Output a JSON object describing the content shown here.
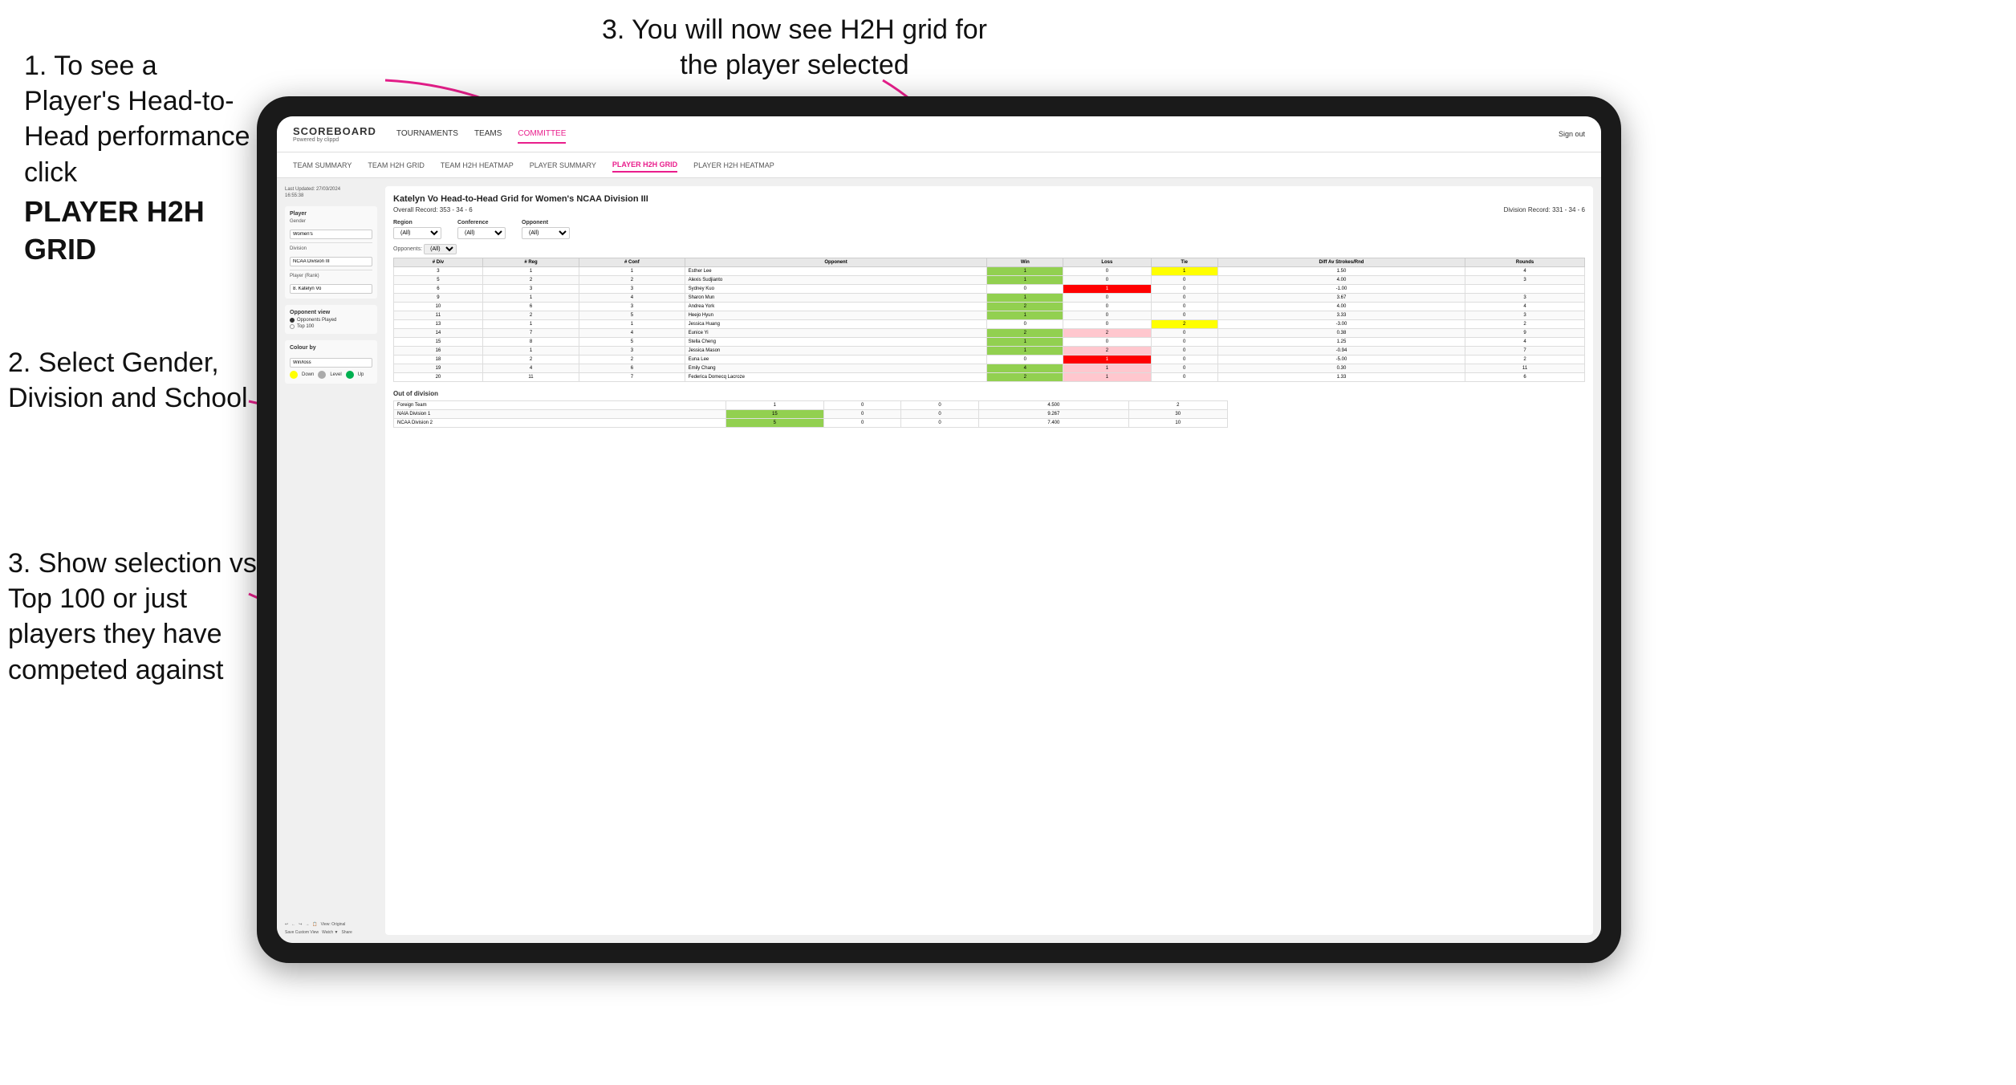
{
  "instructions": {
    "top_left_1": "1. To see a Player's Head-to-Head performance click",
    "top_left_bold": "PLAYER H2H GRID",
    "top_right": "3. You will now see H2H grid for the player selected",
    "bottom_left_2": "2. Select Gender, Division and School",
    "bottom_left_3": "3. Show selection vs Top 100 or just players they have competed against"
  },
  "navbar": {
    "logo": "SCOREBOARD",
    "logo_sub": "Powered by clippd",
    "nav_items": [
      "TOURNAMENTS",
      "TEAMS",
      "COMMITTEE"
    ],
    "active_nav": "COMMITTEE",
    "sign_out": "Sign out"
  },
  "sub_navbar": {
    "items": [
      "TEAM SUMMARY",
      "TEAM H2H GRID",
      "TEAM H2H HEATMAP",
      "PLAYER SUMMARY",
      "PLAYER H2H GRID",
      "PLAYER H2H HEATMAP"
    ],
    "active": "PLAYER H2H GRID"
  },
  "sidebar": {
    "last_updated": "Last Updated: 27/03/2024\n16:55:38",
    "player_label": "Player",
    "gender_label": "Gender",
    "gender_value": "Women's",
    "division_label": "Division",
    "division_value": "NCAA Division III",
    "player_rank_label": "Player (Rank)",
    "player_rank_value": "8. Katelyn Vo",
    "opponent_view_label": "Opponent view",
    "radio_opponents": "Opponents Played",
    "radio_top100": "Top 100",
    "colour_by_label": "Colour by",
    "colour_value": "Win/loss",
    "legend": [
      {
        "color": "#ffff00",
        "label": "Down"
      },
      {
        "color": "#aaaaaa",
        "label": "Level"
      },
      {
        "color": "#00b050",
        "label": "Up"
      }
    ]
  },
  "grid": {
    "title": "Katelyn Vo Head-to-Head Grid for Women's NCAA Division III",
    "overall_record": "Overall Record: 353 - 34 - 6",
    "division_record": "Division Record: 331 - 34 - 6",
    "filters": {
      "region_label": "Region",
      "conference_label": "Conference",
      "opponent_label": "Opponent",
      "opponents_label": "Opponents:",
      "all_option": "(All)"
    },
    "table_headers": [
      "# Div",
      "# Reg",
      "# Conf",
      "Opponent",
      "Win",
      "Loss",
      "Tie",
      "Diff Av Strokes/Rnd",
      "Rounds"
    ],
    "rows": [
      {
        "div": "3",
        "reg": "1",
        "conf": "1",
        "opponent": "Esther Lee",
        "win": "1",
        "loss": "0",
        "tie": "1",
        "diff": "1.50",
        "rounds": "4",
        "win_color": "green",
        "loss_color": "none",
        "tie_color": "yellow"
      },
      {
        "div": "5",
        "reg": "2",
        "conf": "2",
        "opponent": "Alexis Sudjianto",
        "win": "1",
        "loss": "0",
        "tie": "0",
        "diff": "4.00",
        "rounds": "3",
        "win_color": "green",
        "loss_color": "none",
        "tie_color": "none"
      },
      {
        "div": "6",
        "reg": "3",
        "conf": "3",
        "opponent": "Sydney Kuo",
        "win": "0",
        "loss": "1",
        "tie": "0",
        "diff": "-1.00",
        "rounds": "",
        "win_color": "none",
        "loss_color": "red",
        "tie_color": "none"
      },
      {
        "div": "9",
        "reg": "1",
        "conf": "4",
        "opponent": "Sharon Mun",
        "win": "1",
        "loss": "0",
        "tie": "0",
        "diff": "3.67",
        "rounds": "3",
        "win_color": "green",
        "loss_color": "none",
        "tie_color": "none"
      },
      {
        "div": "10",
        "reg": "6",
        "conf": "3",
        "opponent": "Andrea York",
        "win": "2",
        "loss": "0",
        "tie": "0",
        "diff": "4.00",
        "rounds": "4",
        "win_color": "green",
        "loss_color": "none",
        "tie_color": "none"
      },
      {
        "div": "11",
        "reg": "2",
        "conf": "5",
        "opponent": "Heejo Hyun",
        "win": "1",
        "loss": "0",
        "tie": "0",
        "diff": "3.33",
        "rounds": "3",
        "win_color": "green",
        "loss_color": "none",
        "tie_color": "none"
      },
      {
        "div": "13",
        "reg": "1",
        "conf": "1",
        "opponent": "Jessica Huang",
        "win": "0",
        "loss": "0",
        "tie": "2",
        "diff": "-3.00",
        "rounds": "2",
        "win_color": "none",
        "loss_color": "none",
        "tie_color": "yellow"
      },
      {
        "div": "14",
        "reg": "7",
        "conf": "4",
        "opponent": "Eunice Yi",
        "win": "2",
        "loss": "2",
        "tie": "0",
        "diff": "0.38",
        "rounds": "9",
        "win_color": "green",
        "loss_color": "red-light",
        "tie_color": "none"
      },
      {
        "div": "15",
        "reg": "8",
        "conf": "5",
        "opponent": "Stella Cheng",
        "win": "1",
        "loss": "0",
        "tie": "0",
        "diff": "1.25",
        "rounds": "4",
        "win_color": "green",
        "loss_color": "none",
        "tie_color": "none"
      },
      {
        "div": "16",
        "reg": "1",
        "conf": "3",
        "opponent": "Jessica Mason",
        "win": "1",
        "loss": "2",
        "tie": "0",
        "diff": "-0.94",
        "rounds": "7",
        "win_color": "green",
        "loss_color": "red-light",
        "tie_color": "none"
      },
      {
        "div": "18",
        "reg": "2",
        "conf": "2",
        "opponent": "Euna Lee",
        "win": "0",
        "loss": "1",
        "tie": "0",
        "diff": "-5.00",
        "rounds": "2",
        "win_color": "none",
        "loss_color": "red",
        "tie_color": "none"
      },
      {
        "div": "19",
        "reg": "4",
        "conf": "6",
        "opponent": "Emily Chang",
        "win": "4",
        "loss": "1",
        "tie": "0",
        "diff": "0.30",
        "rounds": "11",
        "win_color": "green",
        "loss_color": "red-light",
        "tie_color": "none"
      },
      {
        "div": "20",
        "reg": "11",
        "conf": "7",
        "opponent": "Federica Domecq Lacroze",
        "win": "2",
        "loss": "1",
        "tie": "0",
        "diff": "1.33",
        "rounds": "6",
        "win_color": "green",
        "loss_color": "red-light",
        "tie_color": "none"
      }
    ],
    "out_of_division_label": "Out of division",
    "out_of_division_rows": [
      {
        "opponent": "Foreign Team",
        "win": "1",
        "loss": "0",
        "tie": "0",
        "diff": "4.500",
        "rounds": "2"
      },
      {
        "opponent": "NAIA Division 1",
        "win": "15",
        "loss": "0",
        "tie": "0",
        "diff": "9.267",
        "rounds": "30"
      },
      {
        "opponent": "NCAA Division 2",
        "win": "5",
        "loss": "0",
        "tie": "0",
        "diff": "7.400",
        "rounds": "10"
      }
    ]
  },
  "toolbar": {
    "items": [
      "↩",
      "←",
      "↪",
      "→",
      "📋",
      "↩↪",
      "⏱",
      "View: Original",
      "Save Custom View",
      "Watch ▼",
      "⬡",
      "⬡",
      "Share"
    ]
  }
}
